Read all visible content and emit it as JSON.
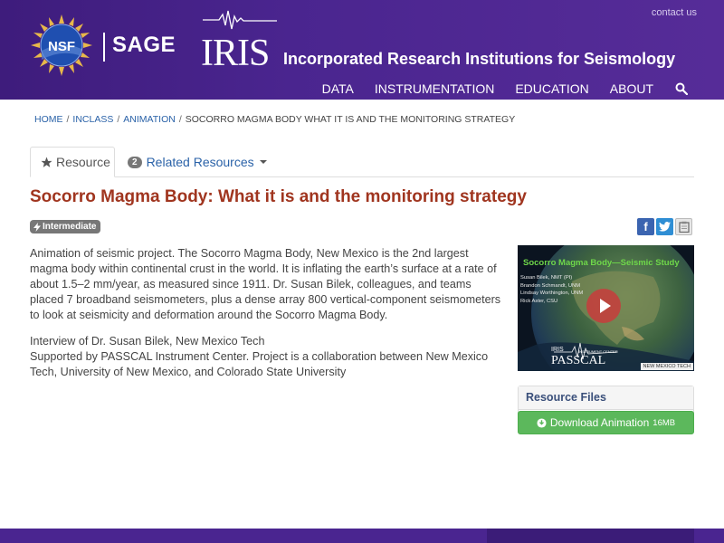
{
  "header": {
    "contact_label": "contact us",
    "nsf_logo_text": "NSF",
    "sage_label": "SAGE",
    "iris_logo_text": "IRIS",
    "iris_title": "Incorporated Research Institutions for Seismology",
    "nav": [
      "DATA",
      "INSTRUMENTATION",
      "EDUCATION",
      "ABOUT"
    ],
    "search_icon": "search-icon"
  },
  "breadcrumb": {
    "items": [
      "HOME",
      "INCLASS",
      "ANIMATION"
    ],
    "current": "SOCORRO MAGMA BODY WHAT IT IS AND THE MONITORING STRATEGY",
    "separator": "/"
  },
  "tabs": {
    "resource_label": "Resource",
    "resource_icon": "star-icon",
    "related_count": "2",
    "related_label": "Related Resources"
  },
  "resource": {
    "title": "Socorro Magma Body: What it is and the monitoring strategy",
    "level": "Intermediate",
    "level_icon": "bolt-icon",
    "description_1": "Animation of seismic project. The Socorro Magma Body, New Mexico is the 2nd largest magma body within continental crust in the world. It is inflating the earth’s surface at a rate of about 1.5–2 mm/year, as measured since 1911. Dr. Susan Bilek, colleagues, and teams placed 7 broadband seismometers, plus a dense array 800 vertical-component seismometers to look at seismicity and deformation around the Socorro Magma Body.",
    "description_2": [
      "Interview of Dr. Susan Bilek, New Mexico Tech",
      "Supported by PASSCAL Instrument Center. Project is a collaboration between New Mexico Tech, University of New Mexico, and Colorado State University"
    ]
  },
  "share": {
    "facebook": "f",
    "twitter": "t",
    "clipboard": "clipboard-icon"
  },
  "video": {
    "title": "Socorro Magma Body—Seismic Study",
    "credits": [
      "Susan Bilek, NMT (PI)",
      "Brandon Schmandt, UNM",
      "Lindsay Worthington, UNM",
      "Rick Aster, CSU"
    ],
    "iris_label": "IRIS",
    "passcal_label": "PASSCAL",
    "instrument_center": "INSTRUMENT CENTER",
    "nmt_label": "NEW MEXICO TECH"
  },
  "resource_files": {
    "heading": "Resource Files",
    "download_label": "Download Animation",
    "download_size": "16MB"
  },
  "colors": {
    "header_purple": "#4a258f",
    "title_red": "#a0351f",
    "link_blue": "#2a62a8",
    "download_green": "#5cb85c"
  }
}
